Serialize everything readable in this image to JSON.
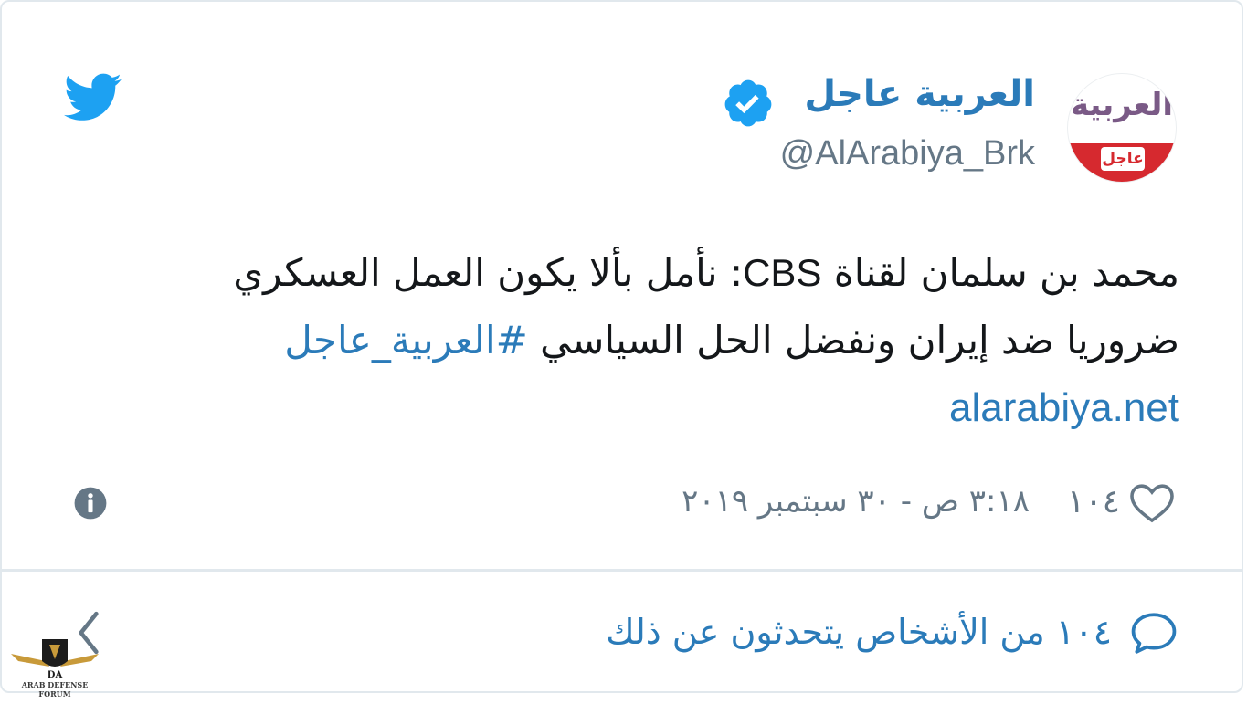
{
  "tweet": {
    "display_name": "العربية عاجل",
    "handle": "@AlArabiya_Brk",
    "avatar_text": {
      "top": "العربية",
      "bottom": "عاجل"
    },
    "text": {
      "line1_part1": "محمد بن سلمان لقناة ",
      "line1_cbs": "CBS",
      "line1_part2": ": نأمل بألا يكون العمل العسكري",
      "line2": "ضروريا ضد إيران ونفضل الحل السياسي ",
      "hashtag": "#العربية_عاجل",
      "link": "alarabiya.net"
    },
    "likes": "١٠٤",
    "timestamp": "٣:١٨ ص - ٣٠ سبتمبر ٢٠١٩",
    "conversation": "١٠٤ من الأشخاص يتحدثون عن ذلك"
  },
  "icons": {
    "brand": "twitter-bird-icon",
    "verified": "verified-badge-icon",
    "info": "info-icon",
    "like": "heart-icon",
    "reply": "speech-bubble-icon",
    "back": "chevron-left-icon"
  },
  "watermark": {
    "text": "ARAB DEFENSE FORUM"
  },
  "colors": {
    "link": "#2b7bb9",
    "muted": "#657786",
    "text": "#14171a",
    "twitter": "#1da1f2",
    "avatar_red": "#d6292f"
  }
}
